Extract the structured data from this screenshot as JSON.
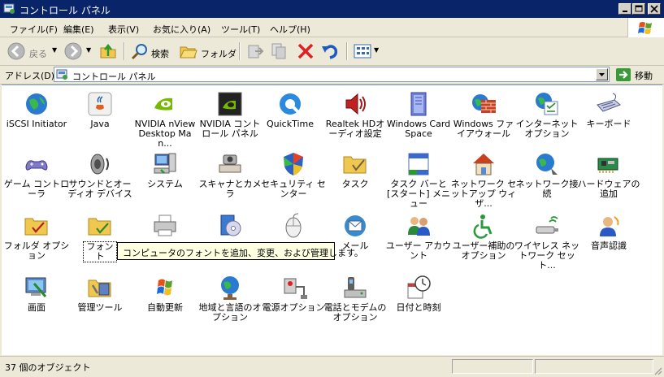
{
  "window": {
    "title": "コントロール パネル"
  },
  "menu": [
    {
      "label": "ファイル(F)"
    },
    {
      "label": "編集(E)"
    },
    {
      "label": "表示(V)"
    },
    {
      "label": "お気に入り(A)"
    },
    {
      "label": "ツール(T)"
    },
    {
      "label": "ヘルプ(H)"
    }
  ],
  "toolbar": {
    "back": "戻る",
    "search": "検索",
    "folders": "フォルダ"
  },
  "address": {
    "label": "アドレス(D)",
    "value": "コントロール パネル",
    "go": "移動"
  },
  "items": [
    {
      "label": "iSCSI Initiator",
      "icon": "globe-icon"
    },
    {
      "label": "Java",
      "icon": "java-icon"
    },
    {
      "label": "NVIDIA nView Desktop Man...",
      "icon": "nvidia-icon"
    },
    {
      "label": "NVIDIA コントロール パネル",
      "icon": "nvidia-panel-icon"
    },
    {
      "label": "QuickTime",
      "icon": "quicktime-icon"
    },
    {
      "label": "Realtek HDオーディオ設定",
      "icon": "speaker-icon"
    },
    {
      "label": "Windows CardSpace",
      "icon": "cardspace-icon"
    },
    {
      "label": "Windows ファイアウォール",
      "icon": "firewall-icon"
    },
    {
      "label": "インターネット オプション",
      "icon": "internet-options-icon"
    },
    {
      "label": "キーボード",
      "icon": "keyboard-icon"
    },
    {
      "label": "ゲーム コントローラ",
      "icon": "gamepad-icon"
    },
    {
      "label": "サウンドとオーディオ デバイス",
      "icon": "sound-icon"
    },
    {
      "label": "システム",
      "icon": "system-icon"
    },
    {
      "label": "スキャナとカメラ",
      "icon": "scanner-icon"
    },
    {
      "label": "セキュリティ センター",
      "icon": "shield-icon"
    },
    {
      "label": "タスク",
      "icon": "task-folder-icon"
    },
    {
      "label": "タスク バーと [スタート] メニュー",
      "icon": "taskbar-icon"
    },
    {
      "label": "ネットワーク セットアップ ウィザ...",
      "icon": "home-network-icon"
    },
    {
      "label": "ネットワーク接続",
      "icon": "network-connection-icon"
    },
    {
      "label": "ハードウェアの追加",
      "icon": "hardware-icon"
    },
    {
      "label": "フォルダ オプション",
      "icon": "folder-options-icon"
    },
    {
      "label": "フォント",
      "icon": "font-folder-icon"
    },
    {
      "label": "",
      "icon": "printer-icon"
    },
    {
      "label": "",
      "icon": "programs-icon"
    },
    {
      "label": "",
      "icon": "mouse-icon"
    },
    {
      "label": "メール",
      "icon": "mail-icon"
    },
    {
      "label": "ユーザー アカウント",
      "icon": "users-icon"
    },
    {
      "label": "ユーザー補助のオプション",
      "icon": "accessibility-icon"
    },
    {
      "label": "ワイヤレス ネットワーク セット...",
      "icon": "wireless-icon"
    },
    {
      "label": "音声認識",
      "icon": "speech-icon"
    },
    {
      "label": "画面",
      "icon": "display-icon"
    },
    {
      "label": "管理ツール",
      "icon": "admin-tools-icon"
    },
    {
      "label": "自動更新",
      "icon": "windows-update-icon"
    },
    {
      "label": "地域と言語のオプション",
      "icon": "region-globe-icon"
    },
    {
      "label": "電源オプション",
      "icon": "power-icon"
    },
    {
      "label": "電話とモデムのオプション",
      "icon": "phone-modem-icon"
    },
    {
      "label": "日付と時刻",
      "icon": "clock-icon"
    }
  ],
  "tooltip": "コンピュータのフォントを追加、変更、および管理します。",
  "status": {
    "text": "37 個のオブジェクト"
  },
  "colors": {
    "titlebar": "#0a246a",
    "chrome": "#ece9d8",
    "tooltip": "#ffffe1"
  }
}
